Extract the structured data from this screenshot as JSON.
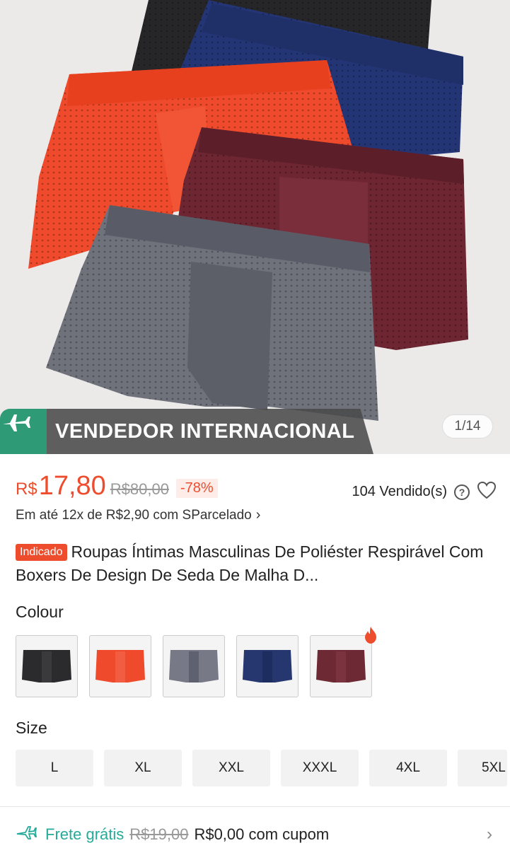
{
  "hero": {
    "banner_text": "VENDEDOR INTERNACIONAL",
    "counter": "1/14",
    "icons": [
      "airplane-icon"
    ]
  },
  "price": {
    "currency": "R$",
    "current": "17,80",
    "original": "R$80,00",
    "discount": "-78%",
    "sold": "104 Vendido(s)"
  },
  "installment": {
    "text": "Em até 12x de R$2,90 com SParcelado"
  },
  "title": {
    "tag": "Indicado",
    "text": "Roupas Íntimas Masculinas De Poliéster Respirável Com Boxers De Design De Seda De Malha D..."
  },
  "colour": {
    "label": "Colour",
    "options": [
      {
        "name": "black",
        "hex": "#2b2b2d"
      },
      {
        "name": "orange",
        "hex": "#ef4a2c"
      },
      {
        "name": "grey",
        "hex": "#777a86"
      },
      {
        "name": "navy",
        "hex": "#26376f"
      },
      {
        "name": "wine",
        "hex": "#6d2a35"
      }
    ]
  },
  "size": {
    "label": "Size",
    "options": [
      "L",
      "XL",
      "XXL",
      "XXXL",
      "4XL",
      "5XL"
    ]
  },
  "shipping": {
    "free_label": "Frete grátis",
    "old_price": "R$19,00",
    "new_price": "R$0,00 com cupom"
  },
  "colors": {
    "accent": "#ee4d2d",
    "teal": "#26aa99",
    "banner_green": "#2e9b76"
  }
}
